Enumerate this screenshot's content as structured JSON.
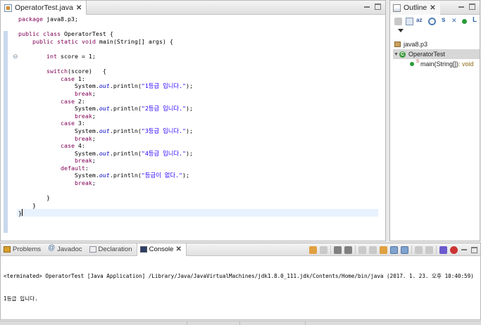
{
  "editor": {
    "tab_title": "OperatorTest.java",
    "lines": [
      [
        {
          "t": "package",
          "c": "kw"
        },
        {
          "t": " java8.p3;"
        }
      ],
      [],
      [
        {
          "t": "public",
          "c": "kw"
        },
        {
          "t": " "
        },
        {
          "t": "class",
          "c": "kw"
        },
        {
          "t": " OperatorTest {"
        }
      ],
      [
        {
          "t": "    "
        },
        {
          "t": "public",
          "c": "kw"
        },
        {
          "t": " "
        },
        {
          "t": "static",
          "c": "kw"
        },
        {
          "t": " "
        },
        {
          "t": "void",
          "c": "kw"
        },
        {
          "t": " main(String[] args) {"
        }
      ],
      [],
      [
        {
          "t": "        "
        },
        {
          "t": "int",
          "c": "kw"
        },
        {
          "t": " score = 1;"
        }
      ],
      [],
      [
        {
          "t": "        "
        },
        {
          "t": "switch",
          "c": "kw"
        },
        {
          "t": "(score)   {"
        }
      ],
      [
        {
          "t": "            "
        },
        {
          "t": "case",
          "c": "kw"
        },
        {
          "t": " 1:"
        }
      ],
      [
        {
          "t": "                System."
        },
        {
          "t": "out",
          "c": "fld"
        },
        {
          "t": ".println("
        },
        {
          "t": "\"1등급 입니다.\"",
          "c": "str"
        },
        {
          "t": ");"
        }
      ],
      [
        {
          "t": "                "
        },
        {
          "t": "break",
          "c": "kw"
        },
        {
          "t": ";"
        }
      ],
      [
        {
          "t": "            "
        },
        {
          "t": "case",
          "c": "kw"
        },
        {
          "t": " 2:"
        }
      ],
      [
        {
          "t": "                System."
        },
        {
          "t": "out",
          "c": "fld"
        },
        {
          "t": ".println("
        },
        {
          "t": "\"2등급 입니다.\"",
          "c": "str"
        },
        {
          "t": ");"
        }
      ],
      [
        {
          "t": "                "
        },
        {
          "t": "break",
          "c": "kw"
        },
        {
          "t": ";"
        }
      ],
      [
        {
          "t": "            "
        },
        {
          "t": "case",
          "c": "kw"
        },
        {
          "t": " 3:"
        }
      ],
      [
        {
          "t": "                System."
        },
        {
          "t": "out",
          "c": "fld"
        },
        {
          "t": ".println("
        },
        {
          "t": "\"3등급 입니다.\"",
          "c": "str"
        },
        {
          "t": ");"
        }
      ],
      [
        {
          "t": "                "
        },
        {
          "t": "break",
          "c": "kw"
        },
        {
          "t": ";"
        }
      ],
      [
        {
          "t": "            "
        },
        {
          "t": "case",
          "c": "kw"
        },
        {
          "t": " 4:"
        }
      ],
      [
        {
          "t": "                System."
        },
        {
          "t": "out",
          "c": "fld"
        },
        {
          "t": ".println("
        },
        {
          "t": "\"4등급 입니다.\"",
          "c": "str"
        },
        {
          "t": ");"
        }
      ],
      [
        {
          "t": "                "
        },
        {
          "t": "break",
          "c": "kw"
        },
        {
          "t": ";"
        }
      ],
      [
        {
          "t": "            "
        },
        {
          "t": "default",
          "c": "kw"
        },
        {
          "t": ":"
        }
      ],
      [
        {
          "t": "                System."
        },
        {
          "t": "out",
          "c": "fld"
        },
        {
          "t": ".println("
        },
        {
          "t": "\"등급이 없다.\"",
          "c": "str"
        },
        {
          "t": ");"
        }
      ],
      [
        {
          "t": "                "
        },
        {
          "t": "break",
          "c": "kw"
        },
        {
          "t": ";"
        }
      ],
      [],
      [
        {
          "t": "        }"
        }
      ],
      [
        {
          "t": "    }"
        }
      ],
      [
        {
          "t": "}"
        }
      ]
    ],
    "current_line": 26
  },
  "outline": {
    "tab_title": "Outline",
    "toolbar_icons": [
      "collapse-all-icon",
      "link-icon",
      "sort-icon",
      "hide-fields-icon",
      "hide-static-icon",
      "hide-nonpublic-icon",
      "public-member-icon",
      "hide-local-types-icon"
    ],
    "tree": {
      "package": "java8.p3",
      "class_name": "OperatorTest",
      "method_name": "main(String[])",
      "method_return": " : void"
    }
  },
  "bottom": {
    "tabs": [
      {
        "label": "Problems",
        "icon": "problems-icon"
      },
      {
        "label": "Javadoc",
        "icon": "javadoc-icon"
      },
      {
        "label": "Declaration",
        "icon": "declaration-icon"
      },
      {
        "label": "Console",
        "icon": "console-icon",
        "active": true
      }
    ],
    "console_header": "<terminated> OperatorTest [Java Application] /Library/Java/JavaVirtualMachines/jdk1.8.0_111.jdk/Contents/Home/bin/java (2017. 1. 23. 오후 10:40:59)",
    "console_output": "1등급 입니다."
  }
}
